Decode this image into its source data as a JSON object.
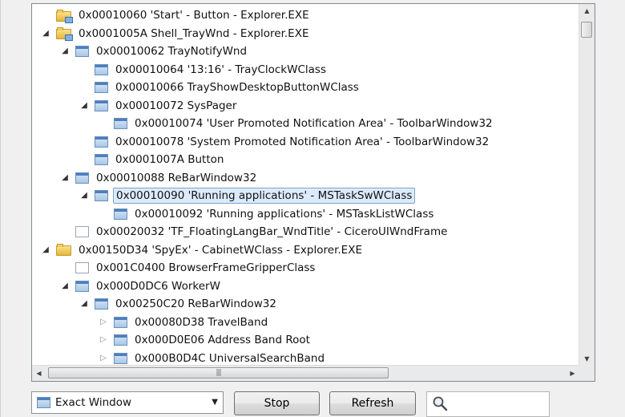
{
  "tree": {
    "rows": [
      {
        "depth": 0,
        "expander": "none",
        "icon": "folder-network",
        "text": "0x00010060 'Start' - Button - Explorer.EXE"
      },
      {
        "depth": 0,
        "expander": "expanded",
        "icon": "folder-network",
        "text": "0x0001005A Shell_TrayWnd - Explorer.EXE"
      },
      {
        "depth": 1,
        "expander": "expanded",
        "icon": "window",
        "text": "0x00010062 TrayNotifyWnd"
      },
      {
        "depth": 2,
        "expander": "none",
        "icon": "window",
        "text": "0x00010064 '13:16' - TrayClockWClass"
      },
      {
        "depth": 2,
        "expander": "none",
        "icon": "window",
        "text": "0x00010066 TrayShowDesktopButtonWClass"
      },
      {
        "depth": 2,
        "expander": "expanded",
        "icon": "window",
        "text": "0x00010072 SysPager"
      },
      {
        "depth": 3,
        "expander": "none",
        "icon": "window",
        "text": "0x00010074 'User Promoted Notification Area' - ToolbarWindow32"
      },
      {
        "depth": 2,
        "expander": "none",
        "icon": "window",
        "text": "0x00010078 'System Promoted Notification Area' - ToolbarWindow32"
      },
      {
        "depth": 2,
        "expander": "none",
        "icon": "window",
        "text": "0x0001007A Button"
      },
      {
        "depth": 1,
        "expander": "expanded",
        "icon": "window",
        "text": "0x00010088 ReBarWindow32"
      },
      {
        "depth": 2,
        "expander": "expanded",
        "icon": "window",
        "text": "0x00010090 'Running applications' - MSTaskSwWClass",
        "selected": true
      },
      {
        "depth": 3,
        "expander": "none",
        "icon": "window",
        "text": "0x00010092 'Running applications' - MSTaskListWClass"
      },
      {
        "depth": 1,
        "expander": "none",
        "icon": "blank-window",
        "text": "0x00020032 'TF_FloatingLangBar_WndTitle' - CiceroUIWndFrame"
      },
      {
        "depth": 0,
        "expander": "expanded",
        "icon": "folder",
        "text": "0x00150D34 'SpyEx' - CabinetWClass - Explorer.EXE"
      },
      {
        "depth": 1,
        "expander": "none",
        "icon": "blank-window",
        "text": "0x001C0400 BrowserFrameGripperClass"
      },
      {
        "depth": 1,
        "expander": "expanded",
        "icon": "window",
        "text": "0x000D0DC6 WorkerW"
      },
      {
        "depth": 2,
        "expander": "expanded",
        "icon": "window",
        "text": "0x00250C20 ReBarWindow32"
      },
      {
        "depth": 3,
        "expander": "collapsed",
        "icon": "window",
        "text": "0x00080D38 TravelBand"
      },
      {
        "depth": 3,
        "expander": "collapsed",
        "icon": "window",
        "text": "0x000D0E06 Address Band Root"
      },
      {
        "depth": 3,
        "expander": "collapsed",
        "icon": "window",
        "text": "0x000B0D4C UniversalSearchBand"
      }
    ]
  },
  "controls": {
    "mode_select": {
      "value": "Exact Window",
      "icon": "window-icon"
    },
    "stop_label": "Stop",
    "refresh_label": "Refresh",
    "find_icon": "magnifier-icon"
  }
}
